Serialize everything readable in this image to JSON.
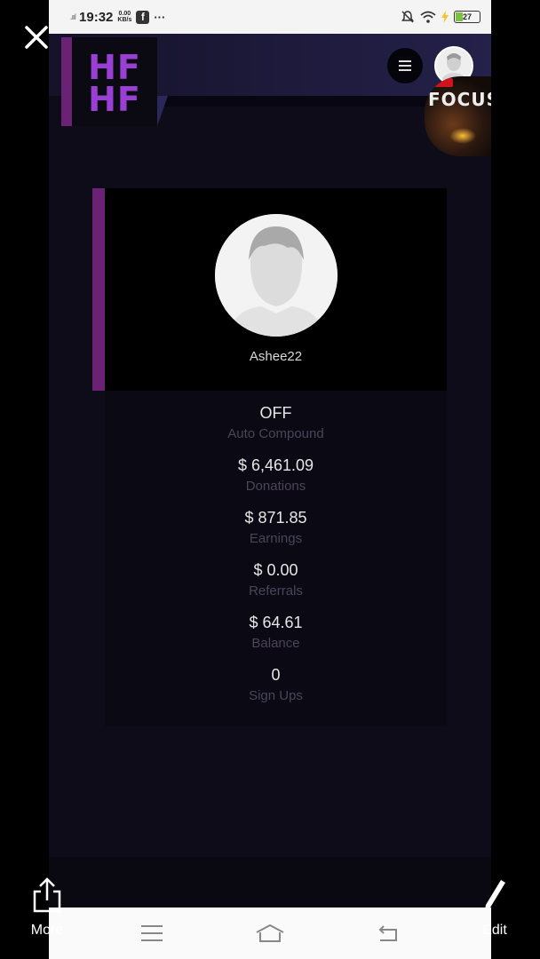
{
  "status_bar": {
    "time": "19:32",
    "speed_top": "0.00",
    "speed_bottom": "KB/s",
    "overflow": "···",
    "battery": "27"
  },
  "header": {
    "logo_line1": "HF",
    "logo_line2": "HF",
    "menu_icon": "hamburger-icon",
    "badge_text": "FOCUS"
  },
  "profile": {
    "username": "Ashee22"
  },
  "stats": [
    {
      "value": "OFF",
      "label": "Auto Compound"
    },
    {
      "value": "$ 6,461.09",
      "label": "Donations"
    },
    {
      "value": "$ 871.85",
      "label": "Earnings"
    },
    {
      "value": "$ 0.00",
      "label": "Referrals"
    },
    {
      "value": "$ 64.61",
      "label": "Balance"
    },
    {
      "value": "0",
      "label": "Sign Ups"
    }
  ],
  "viewer": {
    "more_label": "More",
    "edit_label": "Edit"
  },
  "colors": {
    "accent": "#6a2275",
    "logo": "#9a3fd4",
    "background": "#0f0c1a"
  }
}
